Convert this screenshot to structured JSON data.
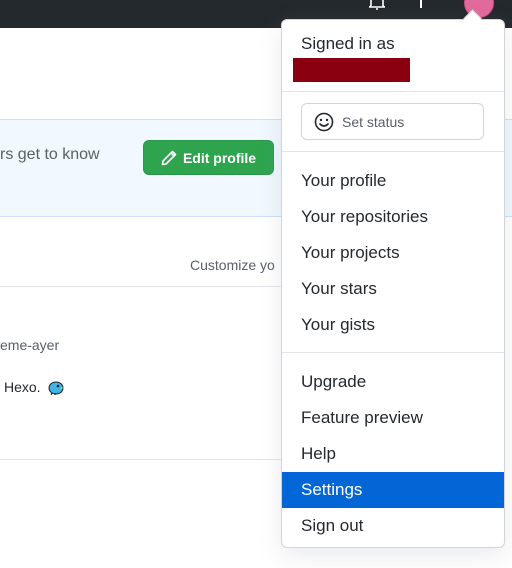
{
  "background": {
    "banner_text": "rs get to know",
    "edit_profile_label": "Edit profile",
    "customize_text": "Customize yo",
    "fragment_1": "eme-ayer",
    "fragment_2": "Hexo."
  },
  "dropdown": {
    "signed_in_label": "Signed in as",
    "set_status_label": "Set status",
    "section1": [
      {
        "label": "Your profile"
      },
      {
        "label": "Your repositories"
      },
      {
        "label": "Your projects"
      },
      {
        "label": "Your stars"
      },
      {
        "label": "Your gists"
      }
    ],
    "section2": [
      {
        "label": "Upgrade"
      },
      {
        "label": "Feature preview"
      },
      {
        "label": "Help"
      },
      {
        "label": "Settings"
      },
      {
        "label": "Sign out"
      }
    ]
  },
  "colors": {
    "header": "#24292e",
    "accent": "#0366d6",
    "button_green": "#2ea44f",
    "redaction": "#8b0010"
  },
  "icons": [
    "bell-icon",
    "plus-icon",
    "avatar",
    "pencil-icon",
    "smiley-icon",
    "bird-emoji-icon"
  ]
}
